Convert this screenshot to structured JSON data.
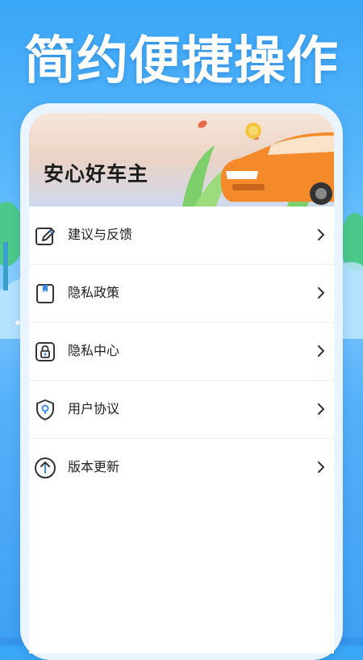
{
  "headline": "简约便捷操作",
  "banner": {
    "title": "安心好车主",
    "icon": "car-illustration"
  },
  "menu": [
    {
      "label": "建议与反馈",
      "icon": "edit-icon"
    },
    {
      "label": "隐私政策",
      "icon": "bookmark-icon"
    },
    {
      "label": "隐私中心",
      "icon": "lock-icon"
    },
    {
      "label": "用户协议",
      "icon": "shield-icon"
    },
    {
      "label": "版本更新",
      "icon": "arrow-up-icon"
    }
  ],
  "colors": {
    "background": "#4aaaf7",
    "card": "#ffffff",
    "text": "#222222",
    "car": "#f58a2b"
  }
}
